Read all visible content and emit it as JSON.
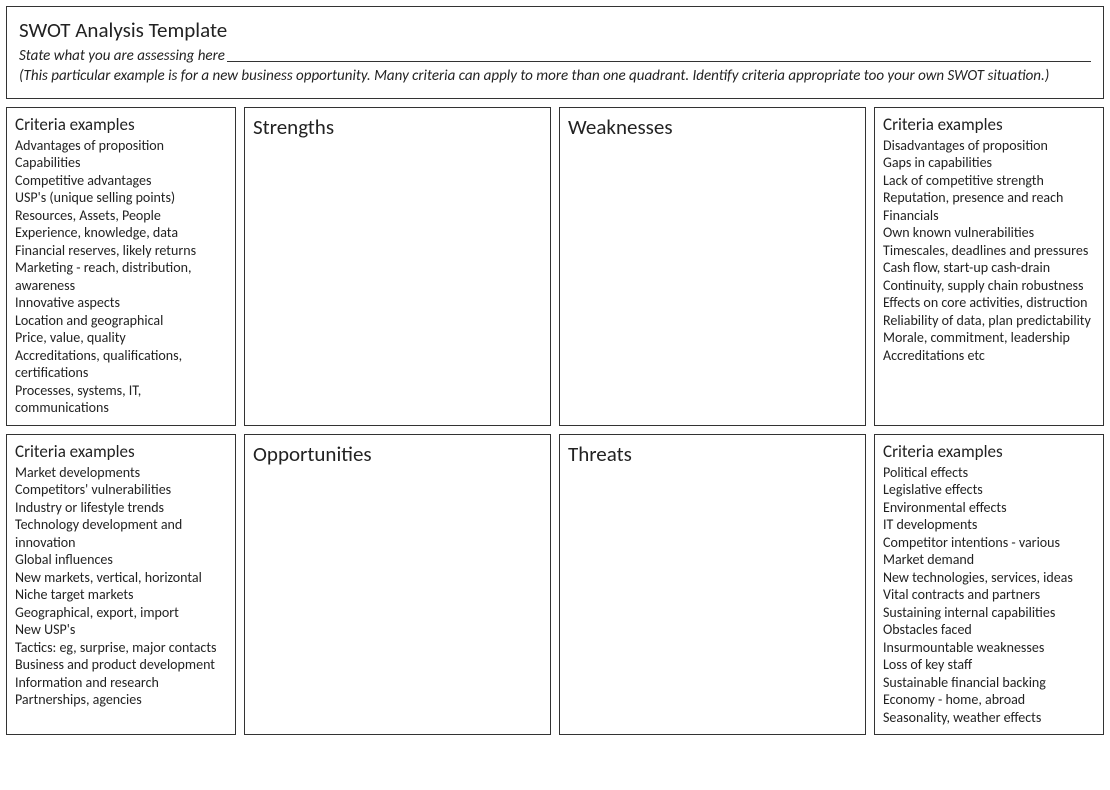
{
  "header": {
    "title": "SWOT Analysis Template",
    "subtitle_label": "State what you are assessing here",
    "description": "(This particular example is for a new business opportunity. Many criteria can apply to more than one quadrant. Identify criteria appropriate too your own SWOT situation.)"
  },
  "quadrants": {
    "strengths": {
      "criteria_heading": "Criteria examples",
      "heading": "Strengths",
      "items": [
        "Advantages of proposition",
        "Capabilities",
        "Competitive advantages",
        "USP's (unique selling points)",
        "Resources, Assets, People",
        "Experience, knowledge, data",
        "Financial reserves, likely returns",
        "Marketing -  reach, distribution, awareness",
        "Innovative aspects",
        "Location and geographical",
        "Price, value, quality",
        "Accreditations, qualifications, certifications",
        "Processes, systems, IT, communications"
      ]
    },
    "weaknesses": {
      "criteria_heading": "Criteria examples",
      "heading": "Weaknesses",
      "items": [
        "Disadvantages of proposition",
        "Gaps in capabilities",
        "Lack of competitive strength",
        "Reputation, presence and reach",
        "Financials",
        "Own known vulnerabilities",
        "Timescales, deadlines and pressures",
        "Cash flow, start-up cash-drain",
        "Continuity, supply chain robustness",
        "Effects on core activities, distruction",
        "Reliability of data, plan predictability",
        "Morale, commitment, leadership",
        "Accreditations etc"
      ]
    },
    "opportunities": {
      "criteria_heading": "Criteria examples",
      "heading": "Opportunities",
      "items": [
        "Market developments",
        "Competitors' vulnerabilities",
        "Industry or lifestyle trends",
        "Technology development and innovation",
        "Global influences",
        "New markets, vertical, horizontal",
        "Niche target markets",
        "Geographical, export, import",
        "New USP's",
        "Tactics: eg, surprise, major contacts",
        "Business and product development",
        "Information and research",
        "Partnerships, agencies"
      ]
    },
    "threats": {
      "criteria_heading": "Criteria examples",
      "heading": "Threats",
      "items": [
        "Political effects",
        "Legislative effects",
        "Environmental effects",
        "IT developments",
        "Competitor intentions - various",
        "Market demand",
        "New technologies, services, ideas",
        "Vital contracts and partners",
        "Sustaining internal capabilities",
        "Obstacles faced",
        "Insurmountable weaknesses",
        "Loss of key staff",
        "Sustainable financial backing",
        "Economy - home, abroad",
        "Seasonality, weather effects"
      ]
    }
  }
}
